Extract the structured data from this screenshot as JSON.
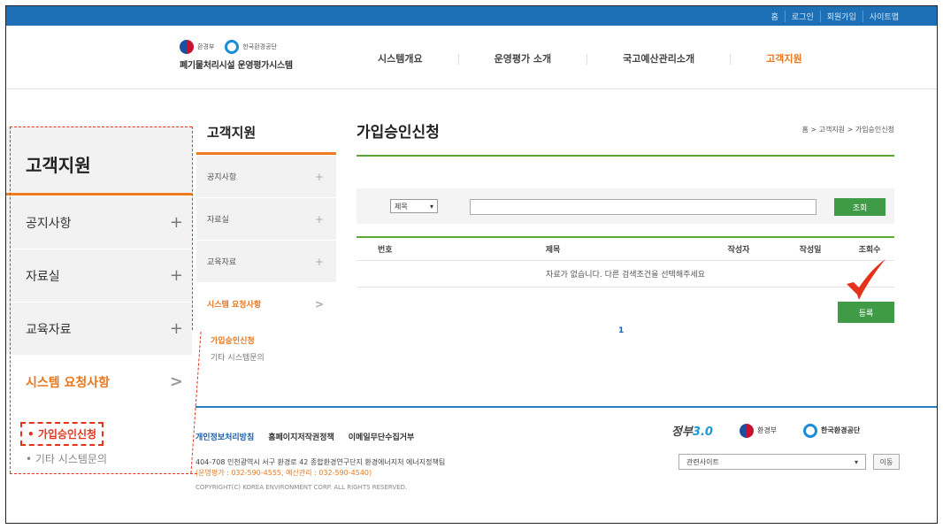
{
  "topbar": {
    "links": [
      "홈",
      "로그인",
      "회원가입",
      "사이트맵"
    ]
  },
  "logo": {
    "me": "환경부",
    "keco": "한국환경공단",
    "system": "폐기물처리시설 운영평가시스템"
  },
  "gnb": [
    "시스템개요",
    "운영평가 소개",
    "국고예산관리소개",
    "고객지원"
  ],
  "zoom": {
    "title": "고객지원",
    "items": [
      "공지사항",
      "자료실",
      "교육자료",
      "시스템 요청사항"
    ],
    "sub": [
      "• 가입승인신청",
      "• 기타 시스템문의"
    ]
  },
  "lnb": {
    "title": "고객지원",
    "items": [
      "공지사항",
      "자료실",
      "교육자료",
      "시스템 요청사항"
    ],
    "sub": [
      "가입승인신청",
      "기타 시스템문의"
    ]
  },
  "content": {
    "title": "가입승인신청",
    "breadcrumb": "홈 > 고객지원 > 가입승인신청",
    "search_select": "제목",
    "search_button": "조회",
    "columns": [
      "번호",
      "제목",
      "작성자",
      "작성일",
      "조회수"
    ],
    "empty": "자료가 없습니다. 다른 검색조건을 선택해주세요",
    "register_button": "등록",
    "page": "1"
  },
  "footer": {
    "links": [
      "개인정보처리방침",
      "홈페이지저작권정책",
      "이메일무단수집거부"
    ],
    "address": "404-708 인천광역시 서구 환경로 42 종합환경연구단지 환경에너지처 에너지정책팀",
    "contact": "(운영평가 : 032-590-4555, 예산관리 : 032-590-4540)",
    "copyright": "COPYRIGHT(C) KOREA ENVIRONMENT CORP. ALL RIGHTS RESERVED.",
    "gov30_a": "정부",
    "gov30_b": "3.0",
    "me": "환경부",
    "keco": "한국환경공단",
    "related_site": "관련사이트",
    "go": "이동"
  },
  "colors": {
    "accent": "#f07c20",
    "green": "#3f9b46",
    "blue": "#1d70b6",
    "red": "#e4321b"
  }
}
